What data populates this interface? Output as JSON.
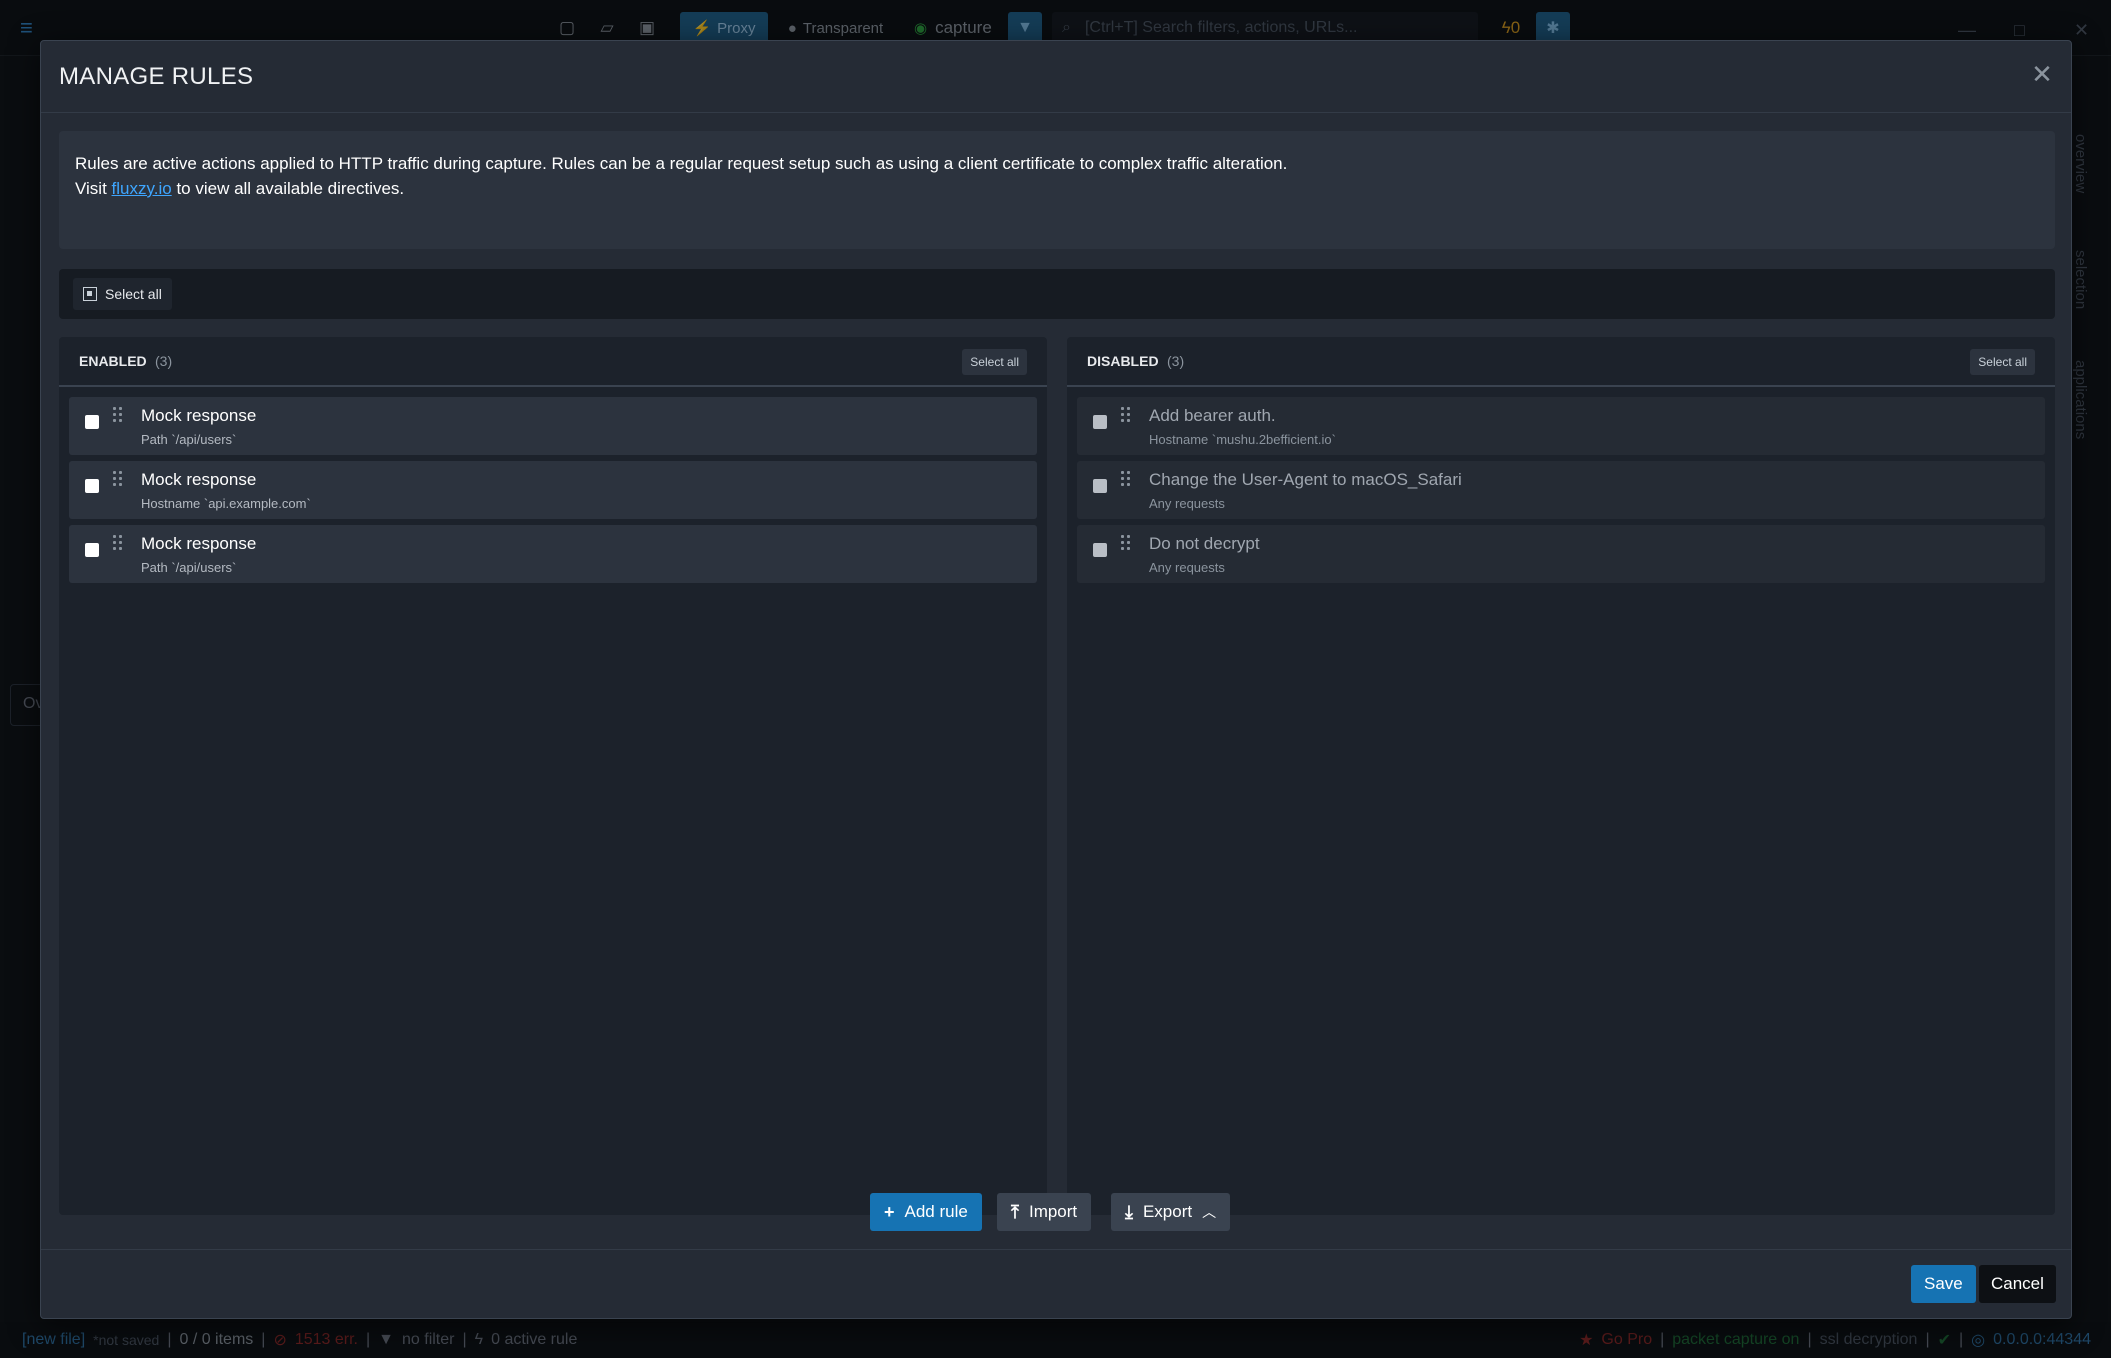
{
  "app": {
    "toolbar": {
      "proxy_label": "Proxy",
      "transparent_label": "Transparent",
      "capture_label": "capture",
      "search_placeholder": "[Ctrl+T] Search filters, actions, URLs...",
      "bolt_count": "0"
    },
    "statusbar": {
      "file_name": "[new file]",
      "file_state": "*not saved",
      "items": "0 / 0 items",
      "errors": "1513 err.",
      "filter": "no filter",
      "active_rules": "0 active rule",
      "go_pro": "Go Pro",
      "packet_capture": "packet capture on",
      "ssl_decryption": "ssl decryption",
      "listen_address": "0.0.0.0:44344"
    },
    "side_tabs": [
      "overview",
      "selection",
      "applications"
    ],
    "left_ghost": "Ov"
  },
  "modal": {
    "title": "MANAGE RULES",
    "info_line1": "Rules are active actions applied to HTTP traffic during capture. Rules can be a regular request setup such as using a client certificate to complex traffic alteration.",
    "info_visit": "Visit",
    "info_link": "fluxzy.io",
    "info_line2_rest": "to view all available directives.",
    "toolbar_select_all": "Select all",
    "enabled": {
      "label": "ENABLED",
      "count": "(3)",
      "select_all": "Select all",
      "rules": [
        {
          "title": "Mock response",
          "subtitle": "Path `/api/users`"
        },
        {
          "title": "Mock response",
          "subtitle": "Hostname `api.example.com`"
        },
        {
          "title": "Mock response",
          "subtitle": "Path `/api/users`"
        }
      ]
    },
    "disabled": {
      "label": "DISABLED",
      "count": "(3)",
      "select_all": "Select all",
      "rules": [
        {
          "title": "Add bearer auth.",
          "subtitle": "Hostname `mushu.2befficient.io`"
        },
        {
          "title": "Change the User-Agent to macOS_Safari",
          "subtitle": "Any requests"
        },
        {
          "title": "Do not decrypt",
          "subtitle": "Any requests"
        }
      ]
    },
    "actions": {
      "add_rule": "Add rule",
      "import": "Import",
      "export": "Export"
    },
    "footer": {
      "save": "Save",
      "cancel": "Cancel"
    }
  },
  "colors": {
    "accent": "#1673b3",
    "modal_bg": "#252b35",
    "link": "#3ea6ff"
  }
}
